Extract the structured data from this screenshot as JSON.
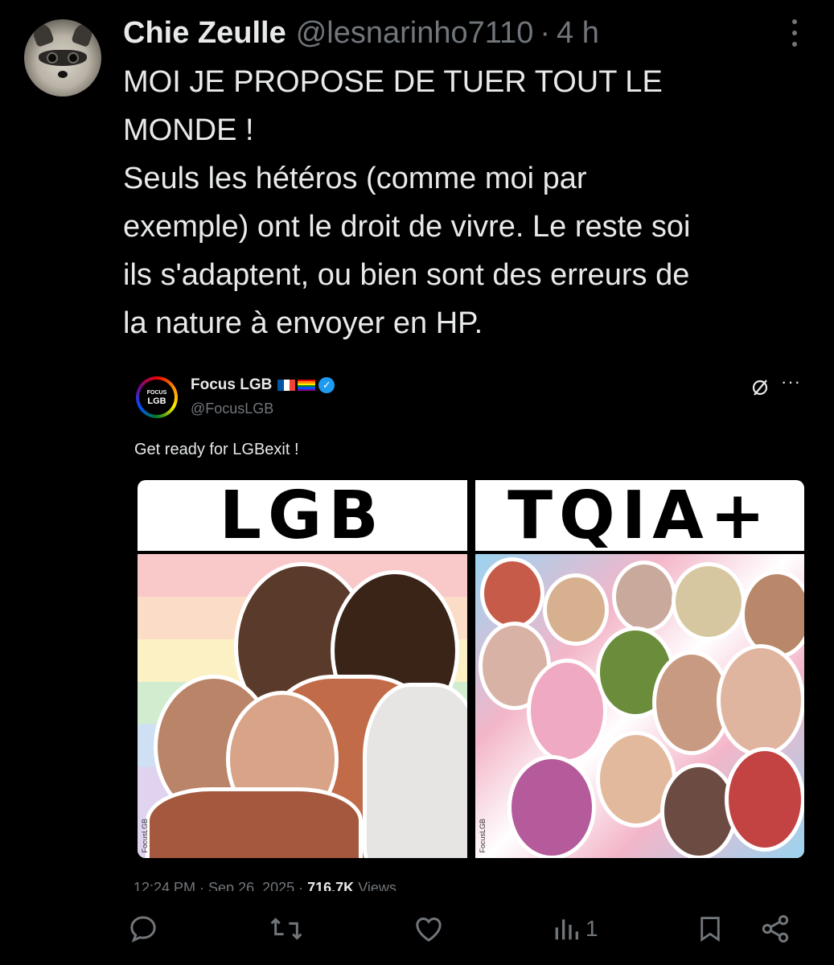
{
  "tweet": {
    "author_name": "Chie Zeulle",
    "author_handle": "@lesnarinho7110",
    "separator": "·",
    "time": "4 h",
    "text": "MOI JE PROPOSE DE TUER TOUT LE\nMONDE !\nSeuls les hétéros (comme moi par\nexemple) ont le droit de vivre. Le reste soi\nils s'adaptent, ou bien sont des erreurs de\nla nature à envoyer en HP."
  },
  "quote": {
    "avatar_text": "FOCUS",
    "avatar_text_2": "LGB",
    "name": "Focus LGB",
    "handle": "@FocusLGB",
    "text": "Get ready for LGBexit !",
    "media": {
      "left_title": "LGB",
      "right_title": "TQIA+",
      "watermark": "FocusLGB"
    },
    "meta_time": "12:24 PM · Sep 26, 2025 · ",
    "meta_views": "716.7K",
    "meta_views_label": " Views"
  },
  "actions": {
    "views_count": "1"
  },
  "colors": {
    "background": "#000000",
    "text": "#e7e9ea",
    "secondary_text": "#71767b",
    "verified": "#1d9bf0"
  },
  "icons": [
    "more-icon",
    "reply-icon",
    "retweet-icon",
    "like-icon",
    "views-icon",
    "bookmark-icon",
    "share-icon",
    "verified-icon",
    "grok-icon",
    "flag-france",
    "flag-rainbow"
  ]
}
